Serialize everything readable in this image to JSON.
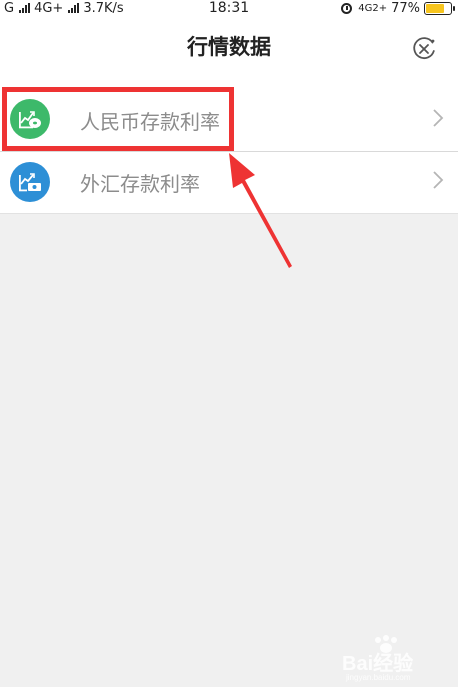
{
  "status_bar": {
    "carrier_1": "G",
    "carrier_2": "4G+",
    "speed": "3.7K/s",
    "time": "18:31",
    "network_right": "4G2+",
    "battery": "77%",
    "battery_level": 0.77,
    "battery_color": "#f7c51e",
    "icons": [
      "signal-icon",
      "alarm-icon",
      "battery-icon"
    ]
  },
  "header": {
    "title": "行情数据",
    "close_icon": "close-circle-icon"
  },
  "list": {
    "items": [
      {
        "label": "人民币存款利率",
        "icon": "rmb-deposit-chart-icon",
        "icon_color": "#3db96a"
      },
      {
        "label": "外汇存款利率",
        "icon": "fx-deposit-chart-icon",
        "icon_color": "#2d8fd6"
      }
    ],
    "chevron_icon": "chevron-right-icon"
  },
  "annotation": {
    "highlight_color": "#ee3333"
  },
  "watermark": {
    "text": "Bai经验",
    "sub": "jingyan.baidu.com"
  }
}
